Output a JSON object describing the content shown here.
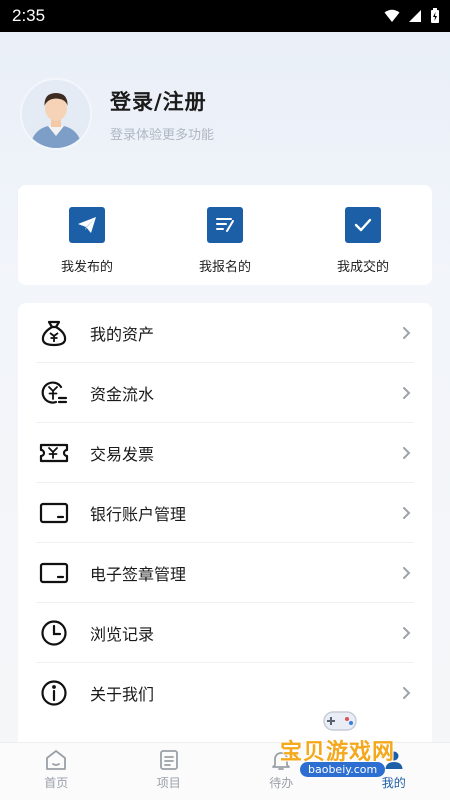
{
  "status_bar": {
    "time": "2:35"
  },
  "profile": {
    "title": "登录/注册",
    "subtitle": "登录体验更多功能"
  },
  "quick_actions": [
    {
      "label": "我发布的",
      "icon": "paper-plane-icon"
    },
    {
      "label": "我报名的",
      "icon": "form-pen-icon"
    },
    {
      "label": "我成交的",
      "icon": "checkmark-icon"
    }
  ],
  "menu": [
    {
      "label": "我的资产",
      "icon": "money-bag-icon"
    },
    {
      "label": "资金流水",
      "icon": "yuan-flow-icon"
    },
    {
      "label": "交易发票",
      "icon": "invoice-ticket-icon"
    },
    {
      "label": "银行账户管理",
      "icon": "card-icon"
    },
    {
      "label": "电子签章管理",
      "icon": "card-icon"
    },
    {
      "label": "浏览记录",
      "icon": "clock-icon"
    },
    {
      "label": "关于我们",
      "icon": "info-icon"
    }
  ],
  "tabs": [
    {
      "label": "首页",
      "icon": "home-icon"
    },
    {
      "label": "项目",
      "icon": "list-icon"
    },
    {
      "label": "待办",
      "icon": "bell-icon"
    },
    {
      "label": "我的",
      "icon": "person-icon",
      "active": true
    }
  ],
  "watermark": {
    "title": "宝贝游戏网",
    "url": "baobeiy.com"
  },
  "colors": {
    "accent": "#1d5fa6",
    "text": "#1a1a1a",
    "muted": "#b0b7c3"
  }
}
